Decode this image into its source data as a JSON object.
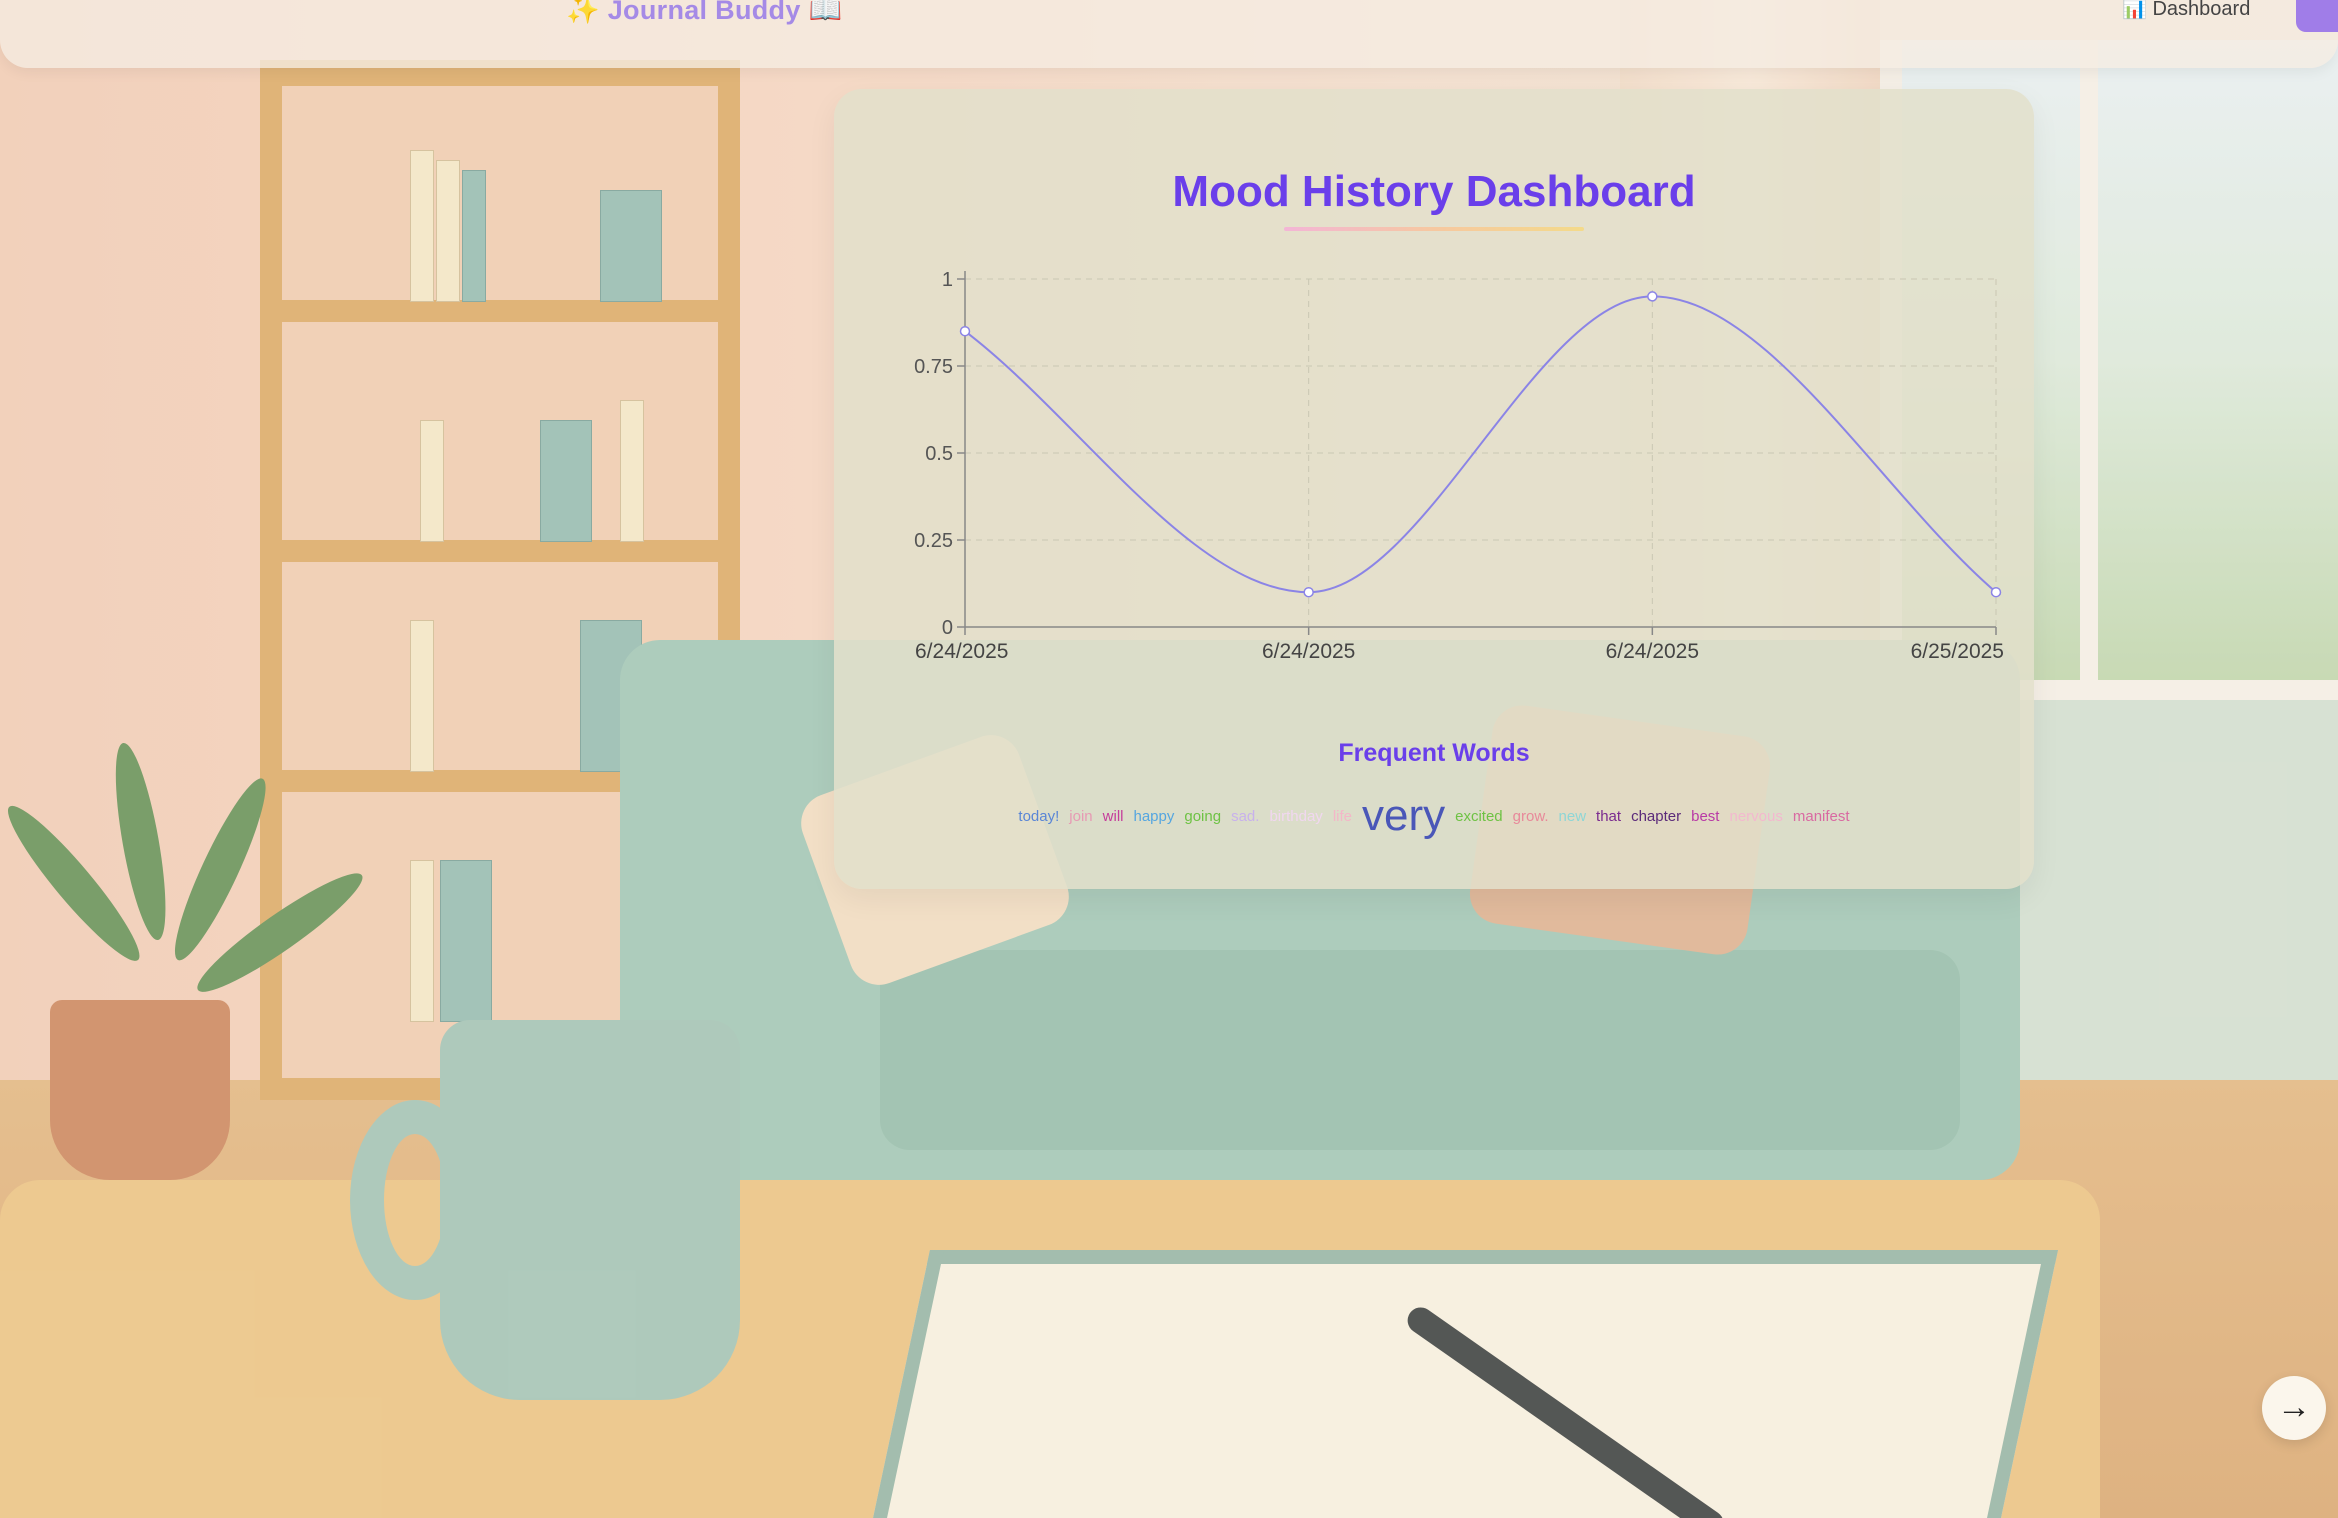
{
  "app": {
    "brand_left_icon": "✨",
    "brand": "Journal Buddy",
    "brand_right_icon": "📖"
  },
  "nav": {
    "dashboard_icon": "📊",
    "dashboard_label": "Dashboard",
    "accent_color": "#a07de8"
  },
  "dashboard": {
    "title": "Mood History Dashboard",
    "words_title": "Frequent Words"
  },
  "chart_data": {
    "type": "line",
    "title": "Mood History Dashboard",
    "xlabel": "",
    "ylabel": "",
    "categories": [
      "6/24/2025",
      "6/24/2025",
      "6/24/2025",
      "6/25/2025"
    ],
    "series": [
      {
        "values": [
          0.85,
          0.1,
          0.95,
          0.1
        ]
      }
    ],
    "ylim": [
      0,
      1
    ],
    "yticks": [
      "0",
      "0.25",
      "0.5",
      "0.75",
      "1"
    ],
    "grid": true,
    "line_color": "#8b84e6"
  },
  "word_cloud": [
    {
      "word": "today!",
      "size": 15,
      "color": "#5a86d6"
    },
    {
      "word": "join",
      "size": 15,
      "color": "#e79ab4"
    },
    {
      "word": "will",
      "size": 15,
      "color": "#c53d9b"
    },
    {
      "word": "happy",
      "size": 15,
      "color": "#55a6e0"
    },
    {
      "word": "going",
      "size": 15,
      "color": "#6ec244"
    },
    {
      "word": "sad.",
      "size": 15,
      "color": "#c8b1ec"
    },
    {
      "word": "birthday",
      "size": 15,
      "color": "#f1d7f0"
    },
    {
      "word": "life",
      "size": 15,
      "color": "#f4b6c8"
    },
    {
      "word": "very",
      "size": 44,
      "color": "#4a57b8"
    },
    {
      "word": "excited",
      "size": 15,
      "color": "#6ec244"
    },
    {
      "word": "grow.",
      "size": 15,
      "color": "#e8899a"
    },
    {
      "word": "new",
      "size": 15,
      "color": "#8ed6d6"
    },
    {
      "word": "that",
      "size": 15,
      "color": "#7a2b8f"
    },
    {
      "word": "chapter",
      "size": 15,
      "color": "#5b2a7a"
    },
    {
      "word": "best",
      "size": 15,
      "color": "#b93aa6"
    },
    {
      "word": "nervous",
      "size": 15,
      "color": "#f3b8cf"
    },
    {
      "word": "manifest",
      "size": 15,
      "color": "#d96aa2"
    }
  ],
  "controls": {
    "next_arrow": "→"
  }
}
